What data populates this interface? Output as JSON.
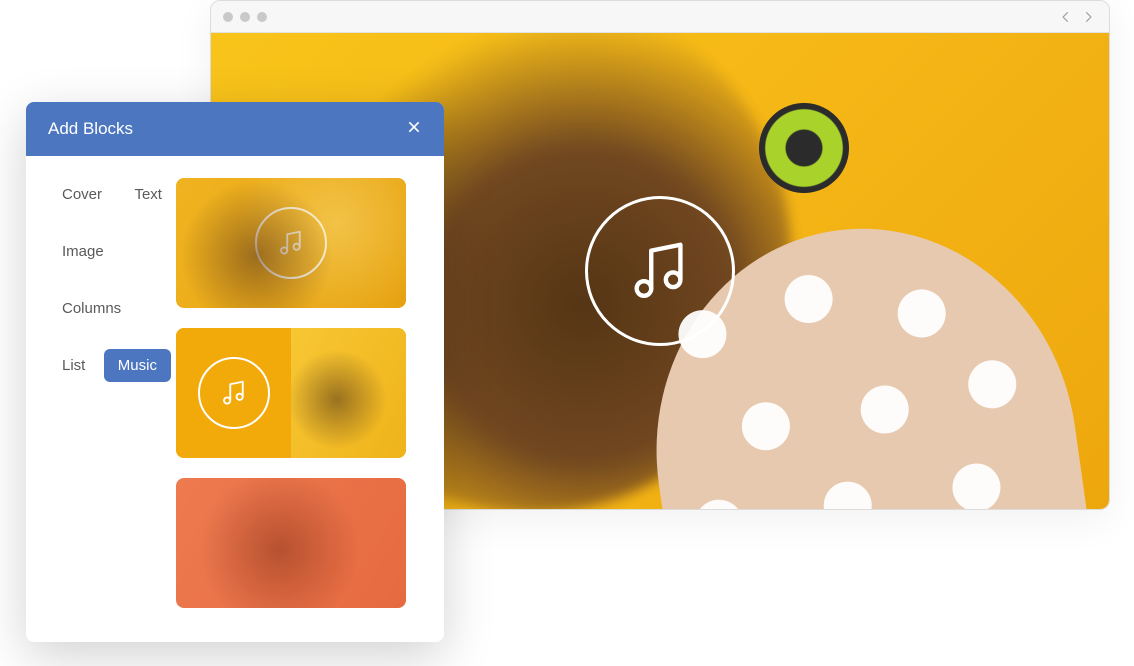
{
  "panel": {
    "title": "Add Blocks",
    "categories": [
      {
        "label": "Cover",
        "active": false
      },
      {
        "label": "Text",
        "active": false
      },
      {
        "label": "Image",
        "active": false
      },
      {
        "label": "Columns",
        "active": false
      },
      {
        "label": "List",
        "active": false
      },
      {
        "label": "Music",
        "active": true
      }
    ],
    "previews": [
      {
        "id": "music-full-overlay",
        "icon": "music-note-icon"
      },
      {
        "id": "music-split",
        "icon": "music-note-icon"
      },
      {
        "id": "music-warm-overlay",
        "icon": "music-note-icon"
      }
    ]
  },
  "main": {
    "play_icon": "music-note-icon"
  },
  "colors": {
    "accent": "#4c76bf",
    "canvas_bg": "#f5b616"
  }
}
